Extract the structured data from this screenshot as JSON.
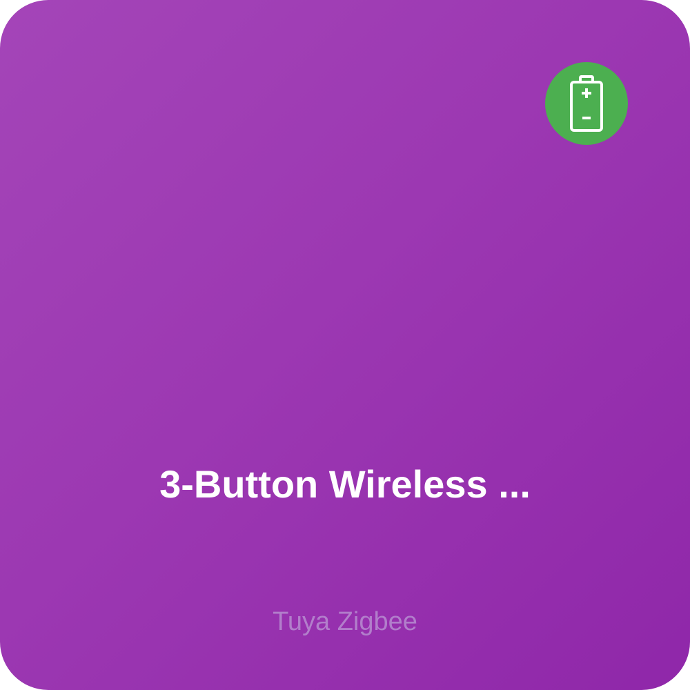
{
  "device": {
    "name": "3-Button Wireless ...",
    "protocol": "Tuya Zigbee"
  },
  "battery_badge": {
    "icon": "battery-icon",
    "color": "#4caf50"
  },
  "colors": {
    "tile_gradient_start": "#a445b8",
    "tile_gradient_end": "#8f27a9",
    "text": "#ffffff"
  }
}
